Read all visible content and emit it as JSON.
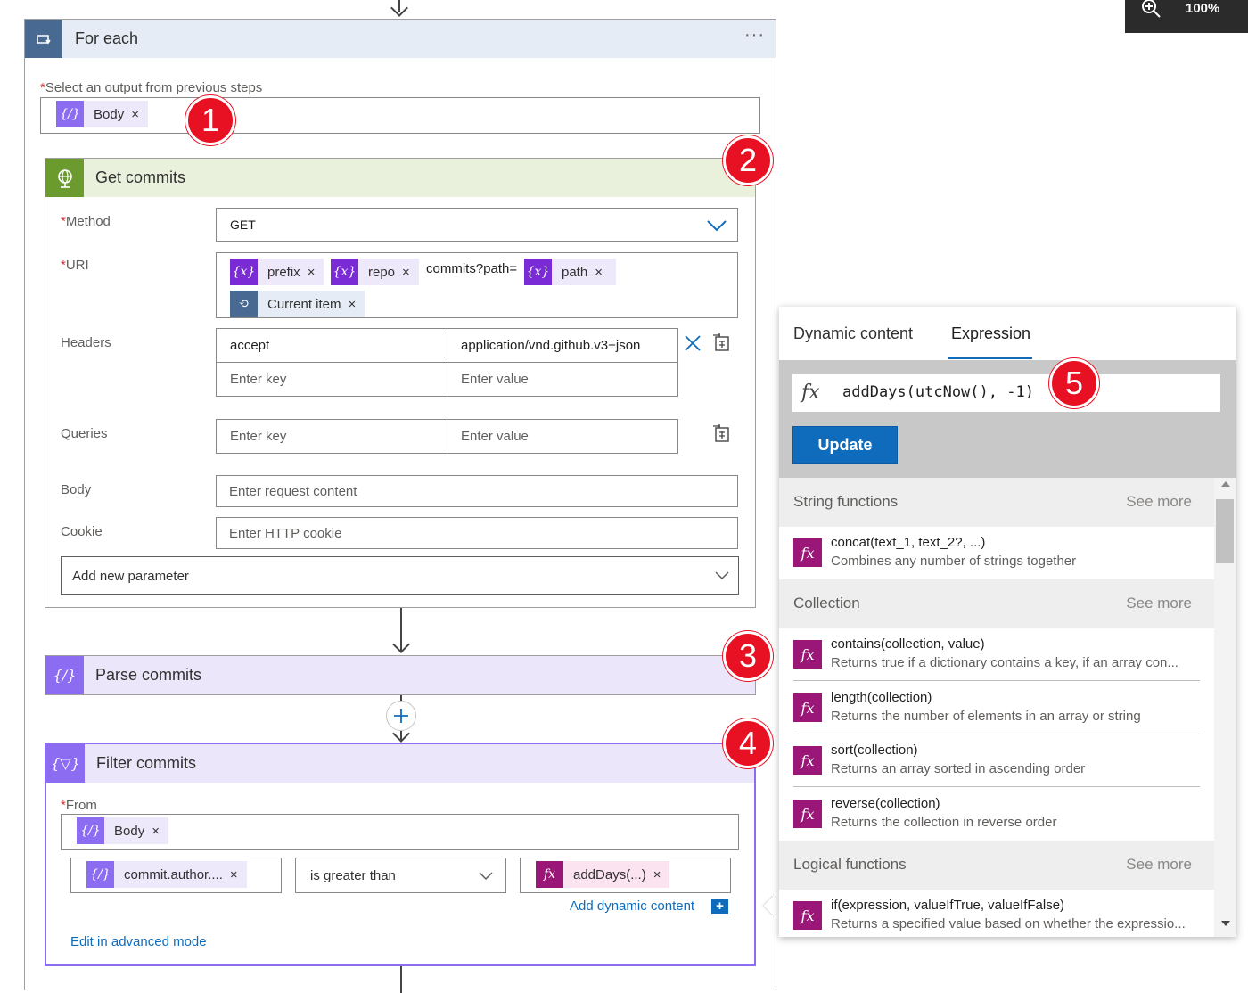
{
  "zoom": {
    "label": "100%"
  },
  "foreach": {
    "title": "For each",
    "more": "···",
    "select_label": "Select an output from previous steps",
    "token": "Body",
    "token_x": "×"
  },
  "get_commits": {
    "title": "Get commits",
    "method_label": "Method",
    "method_value": "GET",
    "uri_label": "URI",
    "uri_tokens": [
      "prefix",
      "repo",
      "path",
      "Current item"
    ],
    "uri_text": "commits?path=",
    "headers_label": "Headers",
    "header_key": "accept",
    "header_value": "application/vnd.github.v3+json",
    "key_placeholder": "Enter key",
    "value_placeholder": "Enter value",
    "queries_label": "Queries",
    "body_label": "Body",
    "body_placeholder": "Enter request content",
    "cookie_label": "Cookie",
    "cookie_placeholder": "Enter HTTP cookie",
    "add_param": "Add new parameter"
  },
  "parse_commits": {
    "title": "Parse commits"
  },
  "filter_commits": {
    "title": "Filter commits",
    "from_label": "From",
    "from_token": "Body",
    "left_token": "commit.author....",
    "operator": "is greater than",
    "right_token": "addDays(...)",
    "add_dynamic": "Add dynamic content",
    "edit_advanced": "Edit in advanced mode"
  },
  "badges": [
    "1",
    "2",
    "3",
    "4",
    "5"
  ],
  "panel": {
    "tab_dynamic": "Dynamic content",
    "tab_expression": "Expression",
    "fx": "fx",
    "expression": "addDays(utcNow(), -1)",
    "update": "Update",
    "see_more": "See more",
    "sections": [
      {
        "title": "String functions",
        "functions": [
          {
            "name": "concat(text_1, text_2?, ...)",
            "desc": "Combines any number of strings together"
          }
        ]
      },
      {
        "title": "Collection",
        "functions": [
          {
            "name": "contains(collection, value)",
            "desc": "Returns true if a dictionary contains a key, if an array con..."
          },
          {
            "name": "length(collection)",
            "desc": "Returns the number of elements in an array or string"
          },
          {
            "name": "sort(collection)",
            "desc": "Returns an array sorted in ascending order"
          },
          {
            "name": "reverse(collection)",
            "desc": "Returns the collection in reverse order"
          }
        ]
      },
      {
        "title": "Logical functions",
        "functions": [
          {
            "name": "if(expression, valueIfTrue, valueIfFalse)",
            "desc": "Returns a specified value based on whether the expressio..."
          }
        ]
      }
    ]
  },
  "colors": {
    "accent": "#0f6cbd",
    "badge": "#e81123",
    "http": "#6b9b2f",
    "parse": "#8c6cf0",
    "fx": "#9a1677"
  }
}
